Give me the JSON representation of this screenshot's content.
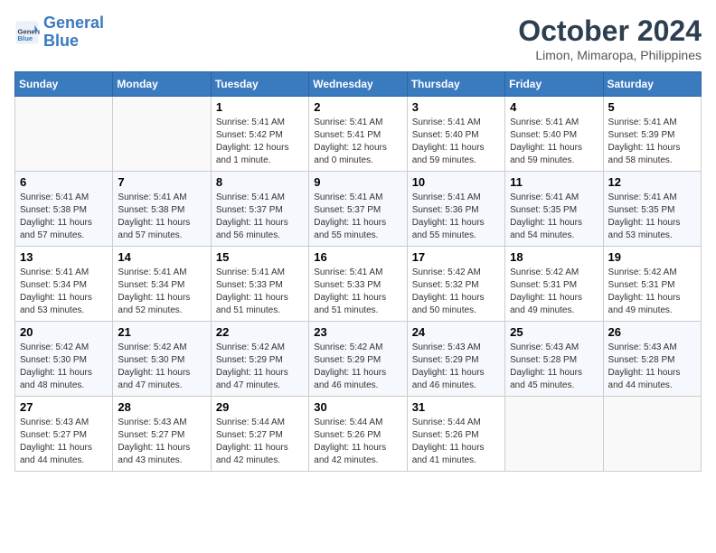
{
  "header": {
    "logo_line1": "General",
    "logo_line2": "Blue",
    "month_title": "October 2024",
    "location": "Limon, Mimaropa, Philippines"
  },
  "weekdays": [
    "Sunday",
    "Monday",
    "Tuesday",
    "Wednesday",
    "Thursday",
    "Friday",
    "Saturday"
  ],
  "weeks": [
    [
      {
        "day": "",
        "info": ""
      },
      {
        "day": "",
        "info": ""
      },
      {
        "day": "1",
        "info": "Sunrise: 5:41 AM\nSunset: 5:42 PM\nDaylight: 12 hours\nand 1 minute."
      },
      {
        "day": "2",
        "info": "Sunrise: 5:41 AM\nSunset: 5:41 PM\nDaylight: 12 hours\nand 0 minutes."
      },
      {
        "day": "3",
        "info": "Sunrise: 5:41 AM\nSunset: 5:40 PM\nDaylight: 11 hours\nand 59 minutes."
      },
      {
        "day": "4",
        "info": "Sunrise: 5:41 AM\nSunset: 5:40 PM\nDaylight: 11 hours\nand 59 minutes."
      },
      {
        "day": "5",
        "info": "Sunrise: 5:41 AM\nSunset: 5:39 PM\nDaylight: 11 hours\nand 58 minutes."
      }
    ],
    [
      {
        "day": "6",
        "info": "Sunrise: 5:41 AM\nSunset: 5:38 PM\nDaylight: 11 hours\nand 57 minutes."
      },
      {
        "day": "7",
        "info": "Sunrise: 5:41 AM\nSunset: 5:38 PM\nDaylight: 11 hours\nand 57 minutes."
      },
      {
        "day": "8",
        "info": "Sunrise: 5:41 AM\nSunset: 5:37 PM\nDaylight: 11 hours\nand 56 minutes."
      },
      {
        "day": "9",
        "info": "Sunrise: 5:41 AM\nSunset: 5:37 PM\nDaylight: 11 hours\nand 55 minutes."
      },
      {
        "day": "10",
        "info": "Sunrise: 5:41 AM\nSunset: 5:36 PM\nDaylight: 11 hours\nand 55 minutes."
      },
      {
        "day": "11",
        "info": "Sunrise: 5:41 AM\nSunset: 5:35 PM\nDaylight: 11 hours\nand 54 minutes."
      },
      {
        "day": "12",
        "info": "Sunrise: 5:41 AM\nSunset: 5:35 PM\nDaylight: 11 hours\nand 53 minutes."
      }
    ],
    [
      {
        "day": "13",
        "info": "Sunrise: 5:41 AM\nSunset: 5:34 PM\nDaylight: 11 hours\nand 53 minutes."
      },
      {
        "day": "14",
        "info": "Sunrise: 5:41 AM\nSunset: 5:34 PM\nDaylight: 11 hours\nand 52 minutes."
      },
      {
        "day": "15",
        "info": "Sunrise: 5:41 AM\nSunset: 5:33 PM\nDaylight: 11 hours\nand 51 minutes."
      },
      {
        "day": "16",
        "info": "Sunrise: 5:41 AM\nSunset: 5:33 PM\nDaylight: 11 hours\nand 51 minutes."
      },
      {
        "day": "17",
        "info": "Sunrise: 5:42 AM\nSunset: 5:32 PM\nDaylight: 11 hours\nand 50 minutes."
      },
      {
        "day": "18",
        "info": "Sunrise: 5:42 AM\nSunset: 5:31 PM\nDaylight: 11 hours\nand 49 minutes."
      },
      {
        "day": "19",
        "info": "Sunrise: 5:42 AM\nSunset: 5:31 PM\nDaylight: 11 hours\nand 49 minutes."
      }
    ],
    [
      {
        "day": "20",
        "info": "Sunrise: 5:42 AM\nSunset: 5:30 PM\nDaylight: 11 hours\nand 48 minutes."
      },
      {
        "day": "21",
        "info": "Sunrise: 5:42 AM\nSunset: 5:30 PM\nDaylight: 11 hours\nand 47 minutes."
      },
      {
        "day": "22",
        "info": "Sunrise: 5:42 AM\nSunset: 5:29 PM\nDaylight: 11 hours\nand 47 minutes."
      },
      {
        "day": "23",
        "info": "Sunrise: 5:42 AM\nSunset: 5:29 PM\nDaylight: 11 hours\nand 46 minutes."
      },
      {
        "day": "24",
        "info": "Sunrise: 5:43 AM\nSunset: 5:29 PM\nDaylight: 11 hours\nand 46 minutes."
      },
      {
        "day": "25",
        "info": "Sunrise: 5:43 AM\nSunset: 5:28 PM\nDaylight: 11 hours\nand 45 minutes."
      },
      {
        "day": "26",
        "info": "Sunrise: 5:43 AM\nSunset: 5:28 PM\nDaylight: 11 hours\nand 44 minutes."
      }
    ],
    [
      {
        "day": "27",
        "info": "Sunrise: 5:43 AM\nSunset: 5:27 PM\nDaylight: 11 hours\nand 44 minutes."
      },
      {
        "day": "28",
        "info": "Sunrise: 5:43 AM\nSunset: 5:27 PM\nDaylight: 11 hours\nand 43 minutes."
      },
      {
        "day": "29",
        "info": "Sunrise: 5:44 AM\nSunset: 5:27 PM\nDaylight: 11 hours\nand 42 minutes."
      },
      {
        "day": "30",
        "info": "Sunrise: 5:44 AM\nSunset: 5:26 PM\nDaylight: 11 hours\nand 42 minutes."
      },
      {
        "day": "31",
        "info": "Sunrise: 5:44 AM\nSunset: 5:26 PM\nDaylight: 11 hours\nand 41 minutes."
      },
      {
        "day": "",
        "info": ""
      },
      {
        "day": "",
        "info": ""
      }
    ]
  ]
}
